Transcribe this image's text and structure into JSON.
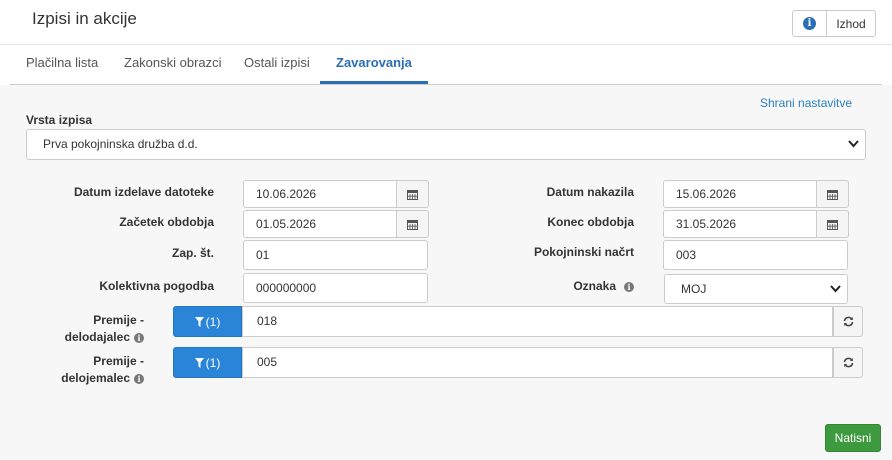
{
  "header": {
    "title": "Izpisi in akcije",
    "info_icon": "info-icon",
    "exit_label": "Izhod"
  },
  "tabs": [
    {
      "label": "Plačilna lista",
      "active": false
    },
    {
      "label": "Zakonski obrazci",
      "active": false
    },
    {
      "label": "Ostali izpisi",
      "active": false
    },
    {
      "label": "Zavarovanja",
      "active": true
    }
  ],
  "save_settings_label": "Shrani nastavitve",
  "report_type": {
    "label": "Vrsta izpisa",
    "value": "Prva pokojninska družba d.d."
  },
  "fields": {
    "file_date": {
      "label": "Datum izdelave datoteke",
      "value": "10.06.2026"
    },
    "period_start": {
      "label": "Začetek obdobja",
      "value": "01.05.2026"
    },
    "seq_no": {
      "label": "Zap. št.",
      "value": "01"
    },
    "collective_agreement": {
      "label": "Kolektivna pogodba",
      "value": "000000000"
    },
    "payment_date": {
      "label": "Datum nakazila",
      "value": "15.06.2026"
    },
    "period_end": {
      "label": "Konec obdobja",
      "value": "31.05.2026"
    },
    "pension_plan": {
      "label": "Pokojninski načrt",
      "value": "003"
    },
    "tag": {
      "label": "Oznaka",
      "value": "MOJ"
    }
  },
  "premiums": [
    {
      "label_line1": "Premije -",
      "label_line2": "delodajalec",
      "filter_label": "(1)",
      "value": "018"
    },
    {
      "label_line1": "Premije -",
      "label_line2": "delojemalec",
      "filter_label": "(1)",
      "value": "005"
    }
  ],
  "print_label": "Natisni",
  "colors": {
    "accent": "#2a6fb5",
    "filter_button": "#2a85d8",
    "print_button": "#3e9a3e"
  }
}
